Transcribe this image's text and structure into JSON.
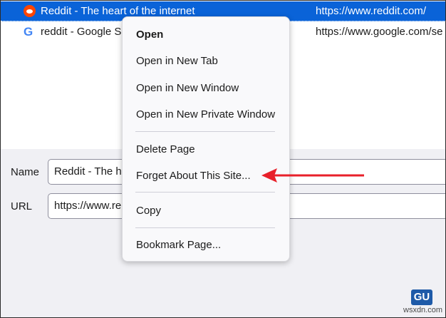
{
  "history": [
    {
      "title": "Reddit - The heart of the internet",
      "url": "https://www.reddit.com/",
      "icon": "reddit-icon",
      "selected": true
    },
    {
      "title": "reddit - Google S",
      "url": "https://www.google.com/se",
      "icon": "google-icon",
      "selected": false
    }
  ],
  "details": {
    "name_label": "Name",
    "name_value": "Reddit - The h",
    "url_label": "URL",
    "url_value": "https://www.re"
  },
  "menu": {
    "open": "Open",
    "open_new_tab": "Open in New Tab",
    "open_new_window": "Open in New Window",
    "open_private_window": "Open in New Private Window",
    "delete_page": "Delete Page",
    "forget_site": "Forget About This Site...",
    "copy": "Copy",
    "bookmark_page": "Bookmark Page..."
  },
  "annotation": {
    "color": "#e8202a"
  },
  "watermark": {
    "logo": "GU",
    "text": "wsxdn.com"
  },
  "colors": {
    "selection": "#0a63d8",
    "panel": "#f0f0f4"
  }
}
